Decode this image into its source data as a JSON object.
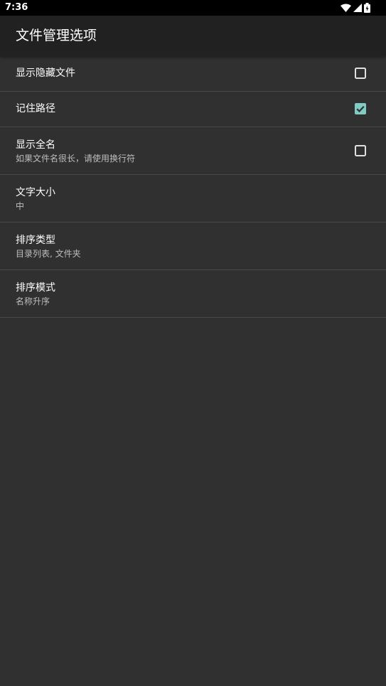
{
  "status_bar": {
    "time": "7:36",
    "icons": [
      "wifi-icon",
      "cell-signal-icon",
      "battery-charging-icon"
    ]
  },
  "app_bar": {
    "title": "文件管理选项"
  },
  "settings": [
    {
      "title": "显示隐藏文件",
      "checkbox": true,
      "checked": false
    },
    {
      "title": "记住路径",
      "checkbox": true,
      "checked": true
    },
    {
      "title": "显示全名",
      "subtitle": "如果文件名很长，请使用换行符",
      "checkbox": true,
      "checked": false
    },
    {
      "title": "文字大小",
      "subtitle": "中",
      "checkbox": false
    },
    {
      "title": "排序类型",
      "subtitle": "目录列表, 文件夹",
      "checkbox": false
    },
    {
      "title": "排序模式",
      "subtitle": "名称升序",
      "checkbox": false
    }
  ],
  "colors": {
    "background": "#303030",
    "app_bar": "#212121",
    "status_bar": "#000000",
    "accent": "#80cbc4",
    "divider": "#4a4a4a"
  }
}
